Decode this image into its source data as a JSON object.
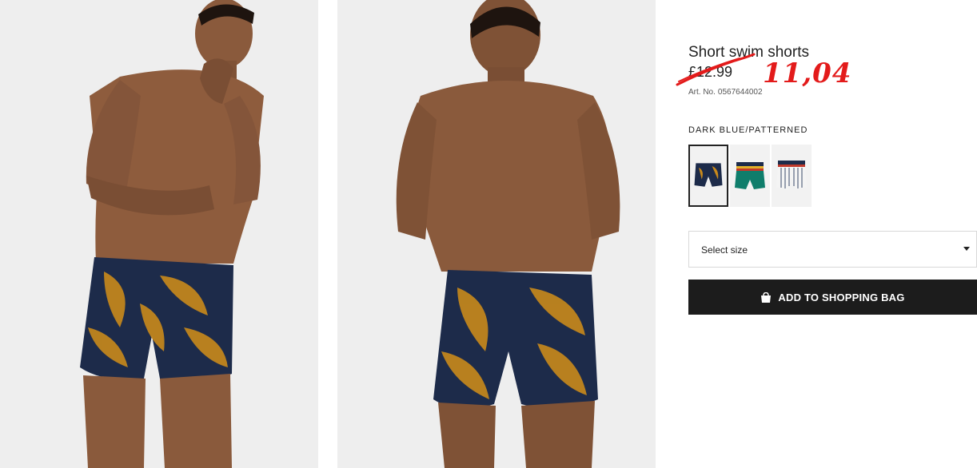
{
  "product": {
    "title": "Short swim shorts",
    "old_price": "£12.99",
    "new_price": "11,04",
    "art_no_label": "Art. No.",
    "art_no": "0567644002",
    "color_name": "DARK BLUE/PATTERNED"
  },
  "swatches": [
    {
      "name": "dark-blue-patterned",
      "selected": true
    },
    {
      "name": "green-striped",
      "selected": false
    },
    {
      "name": "white-striped",
      "selected": false
    }
  ],
  "size_select": {
    "label": "Select size"
  },
  "add_to_bag": {
    "label": "ADD TO SHOPPING BAG",
    "icon": "shopping-bag-icon"
  },
  "colors": {
    "annotation_red": "#e31b1b",
    "button_bg": "#1c1c1c",
    "photo_bg": "#eeeeee"
  }
}
